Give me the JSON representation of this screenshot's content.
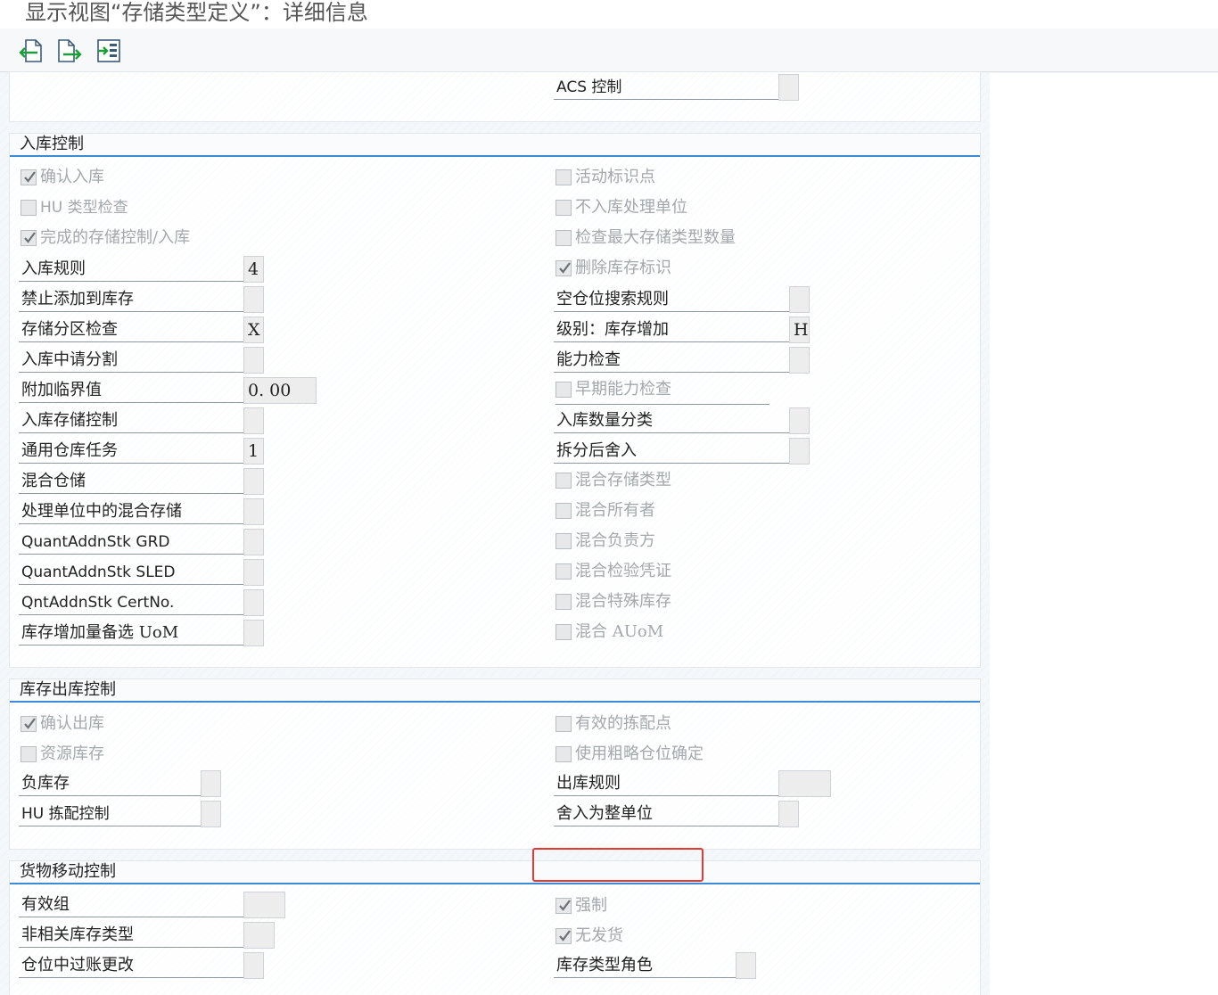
{
  "window": {
    "title": "显示视图“存储类型定义”：详细信息"
  },
  "toolbar": {
    "buttons": [
      "previous-entry",
      "next-entry",
      "other-entry"
    ]
  },
  "top_group": {
    "acs_label": "ACS 控制",
    "acs_value": ""
  },
  "putaway": {
    "title": "入库控制",
    "left_checks": [
      {
        "label": "确认入库",
        "checked": true
      },
      {
        "label": "HU 类型检查",
        "checked": false
      },
      {
        "label": "完成的存储控制/入库",
        "checked": true
      }
    ],
    "left_fields": [
      {
        "label": "入库规则",
        "value": "4"
      },
      {
        "label": "禁止添加到库存",
        "value": ""
      },
      {
        "label": "存储分区检查",
        "value": "X"
      },
      {
        "label": "入库中请分割",
        "value": ""
      },
      {
        "label": "附加临界值",
        "value": "0. 00"
      },
      {
        "label": "入库存储控制",
        "value": ""
      },
      {
        "label": "通用仓库任务",
        "value": "1"
      },
      {
        "label": "混合仓储",
        "value": ""
      },
      {
        "label": "处理单位中的混合存储",
        "value": ""
      },
      {
        "label": "QuantAddnStk GRD",
        "value": ""
      },
      {
        "label": "QuantAddnStk SLED",
        "value": ""
      },
      {
        "label": "QntAddnStk CertNo.",
        "value": ""
      },
      {
        "label": "库存增加量备选 UoM",
        "value": ""
      }
    ],
    "right_checks_top": [
      {
        "label": "活动标识点",
        "checked": false
      },
      {
        "label": "不入库处理单位",
        "checked": false
      },
      {
        "label": "检查最大存储类型数量",
        "checked": false
      },
      {
        "label": "删除库存标识",
        "checked": true
      }
    ],
    "right_fields": [
      {
        "label": "空仓位搜索规则",
        "value": ""
      },
      {
        "label": "级别：库存增加",
        "value": "H"
      },
      {
        "label": "能力检查",
        "value": ""
      }
    ],
    "right_check_mid": {
      "label": "早期能力检查",
      "checked": false
    },
    "right_fields_2": [
      {
        "label": "入库数量分类",
        "value": ""
      },
      {
        "label": "拆分后舍入",
        "value": ""
      }
    ],
    "right_checks_bottom": [
      {
        "label": "混合存储类型",
        "checked": false
      },
      {
        "label": "混合所有者",
        "checked": false
      },
      {
        "label": "混合负责方",
        "checked": false
      },
      {
        "label": "混合检验凭证",
        "checked": false
      },
      {
        "label": "混合特殊库存",
        "checked": false
      },
      {
        "label": "混合 AUoM",
        "checked": false
      }
    ]
  },
  "removal": {
    "title": "库存出库控制",
    "left_checks": [
      {
        "label": "确认出库",
        "checked": true
      },
      {
        "label": "资源库存",
        "checked": false
      }
    ],
    "left_fields": [
      {
        "label": "负库存",
        "value": ""
      },
      {
        "label": "HU 拣配控制",
        "value": ""
      }
    ],
    "right_checks": [
      {
        "label": "有效的拣配点",
        "checked": false
      },
      {
        "label": "使用粗略仓位确定",
        "checked": false
      }
    ],
    "right_fields": [
      {
        "label": "出库规则",
        "value": ""
      },
      {
        "label": "舍入为整单位",
        "value": ""
      }
    ]
  },
  "goods_movement": {
    "title": "货物移动控制",
    "left_fields": [
      {
        "label": "有效组",
        "value": ""
      },
      {
        "label": "非相关库存类型",
        "value": ""
      },
      {
        "label": "仓位中过账更改",
        "value": ""
      }
    ],
    "right_checks": [
      {
        "label": "强制",
        "checked": true
      },
      {
        "label": "无发货",
        "checked": true
      }
    ],
    "right_fields": [
      {
        "label": "库存类型角色",
        "value": ""
      }
    ]
  },
  "colors": {
    "group_title_underline": "#3d8ad6",
    "highlight": "#e53935",
    "disabled_text": "#a3a8ad"
  }
}
